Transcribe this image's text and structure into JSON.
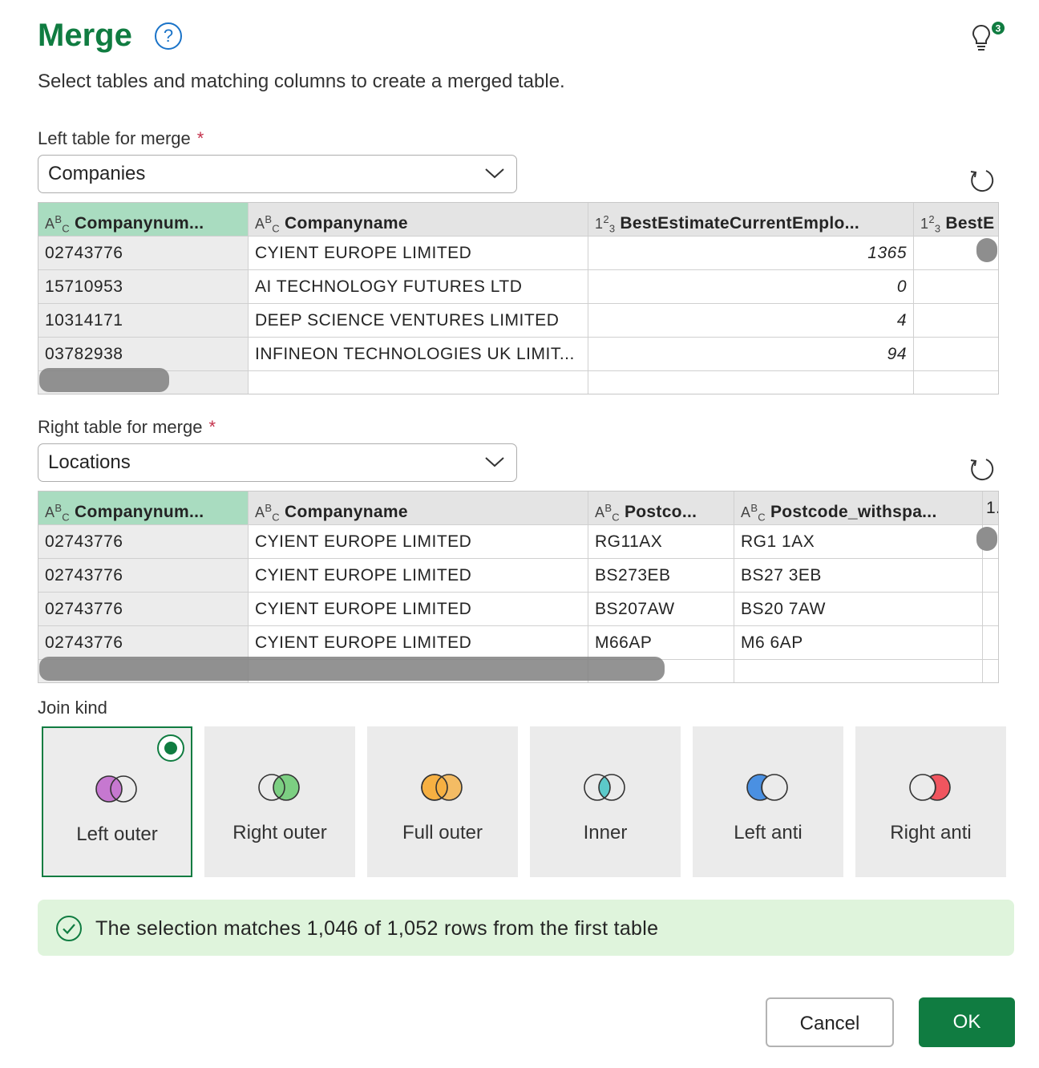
{
  "header": {
    "title": "Merge",
    "help_icon": "question-circle-icon",
    "subtitle": "Select tables and matching columns to create a merged table.",
    "tips_badge": "3"
  },
  "left": {
    "label": "Left table for merge",
    "required_mark": "*",
    "selected": "Companies",
    "columns": [
      {
        "type_prefix": "A",
        "type_sup": "B",
        "type_sub": "C",
        "name": "Companynum..."
      },
      {
        "type_prefix": "A",
        "type_sup": "B",
        "type_sub": "C",
        "name": "Companyname"
      },
      {
        "type_prefix": "1",
        "type_sup": "2",
        "type_sub": "3",
        "name": "BestEstimateCurrentEmplo..."
      },
      {
        "type_prefix": "1",
        "type_sup": "2",
        "type_sub": "3",
        "name": "BestE"
      }
    ],
    "rows": [
      [
        "02743776",
        "CYIENT EUROPE LIMITED",
        "1365"
      ],
      [
        "15710953",
        "AI TECHNOLOGY FUTURES LTD",
        "0"
      ],
      [
        "10314171",
        "DEEP SCIENCE VENTURES LIMITED",
        "4"
      ],
      [
        "03782938",
        "INFINEON TECHNOLOGIES UK LIMIT...",
        "94"
      ]
    ]
  },
  "right": {
    "label": "Right table for merge",
    "required_mark": "*",
    "selected": "Locations",
    "columns": [
      {
        "type_prefix": "A",
        "type_sup": "B",
        "type_sub": "C",
        "name": "Companynum..."
      },
      {
        "type_prefix": "A",
        "type_sup": "B",
        "type_sub": "C",
        "name": "Companyname"
      },
      {
        "type_prefix": "A",
        "type_sup": "B",
        "type_sub": "C",
        "name": "Postco..."
      },
      {
        "type_prefix": "A",
        "type_sup": "B",
        "type_sub": "C",
        "name": "Postcode_withspa..."
      },
      {
        "type_prefix": "",
        "type_sup": "",
        "type_sub": "",
        "name": "1."
      }
    ],
    "rows": [
      [
        "02743776",
        "CYIENT EUROPE LIMITED",
        "RG11AX",
        "RG1 1AX"
      ],
      [
        "02743776",
        "CYIENT EUROPE LIMITED",
        "BS273EB",
        "BS27 3EB"
      ],
      [
        "02743776",
        "CYIENT EUROPE LIMITED",
        "BS207AW",
        "BS20 7AW"
      ],
      [
        "02743776",
        "CYIENT EUROPE LIMITED",
        "M66AP",
        "M6 6AP"
      ]
    ]
  },
  "join": {
    "label": "Join kind",
    "selected": "left-outer",
    "options": [
      {
        "id": "left-outer",
        "label": "Left outer",
        "color": "#c678d0"
      },
      {
        "id": "right-outer",
        "label": "Right outer",
        "color": "#7ccf82"
      },
      {
        "id": "full-outer",
        "label": "Full outer",
        "color": "#f6b042"
      },
      {
        "id": "inner",
        "label": "Inner",
        "color": "#5cc9c9"
      },
      {
        "id": "left-anti",
        "label": "Left anti",
        "color": "#4a90e2"
      },
      {
        "id": "right-anti",
        "label": "Right anti",
        "color": "#f0555f"
      }
    ]
  },
  "status": {
    "message": "The selection matches 1,046 of 1,052 rows from the first table",
    "color": "#107c41"
  },
  "actions": {
    "cancel": "Cancel",
    "ok": "OK"
  },
  "colors": {
    "accent": "#107c41",
    "selected_header": "#a9dcc0"
  }
}
